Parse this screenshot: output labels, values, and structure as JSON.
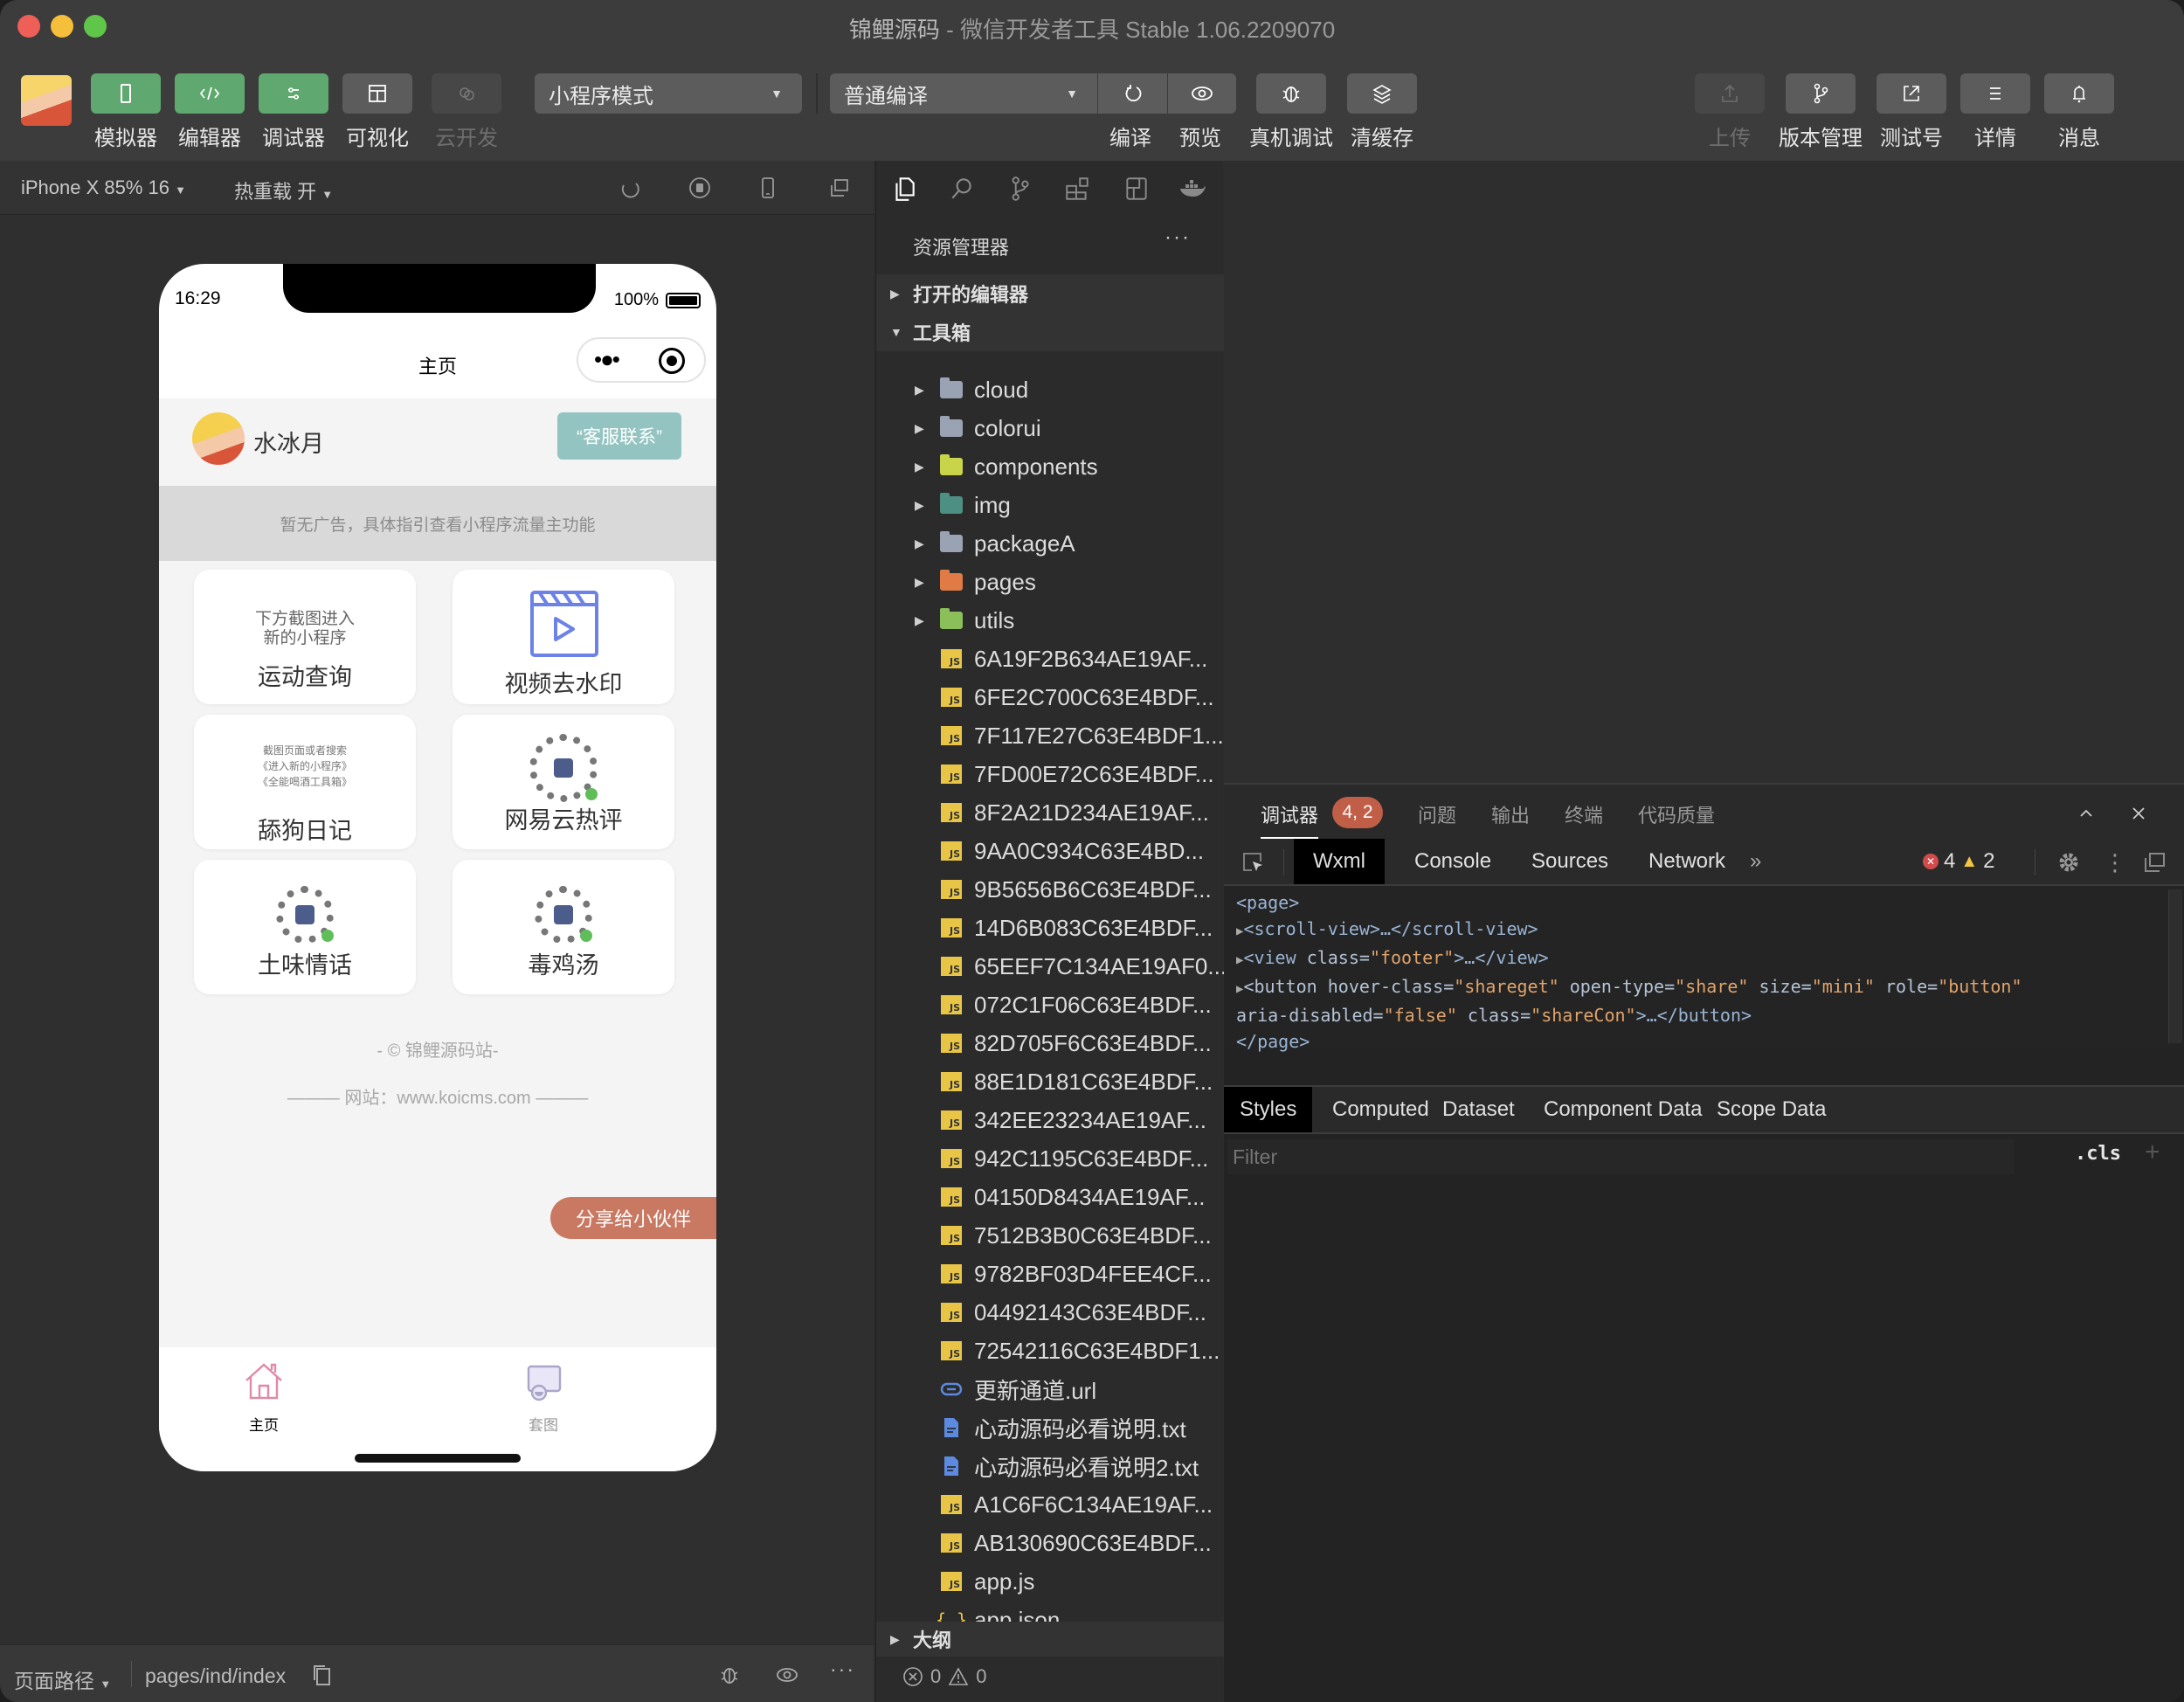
{
  "window": {
    "title_project": "锦鲤源码",
    "title_rest": " - 微信开发者工具 Stable 1.06.2209070"
  },
  "toolbar": {
    "left_buttons": [
      {
        "label": "模拟器",
        "icon": "phone-icon",
        "state": "active"
      },
      {
        "label": "编辑器",
        "icon": "code-icon",
        "state": "active"
      },
      {
        "label": "调试器",
        "icon": "sliders-icon",
        "state": "active"
      },
      {
        "label": "可视化",
        "icon": "layout-icon",
        "state": "normal"
      },
      {
        "label": "云开发",
        "icon": "cloud-icon",
        "state": "disabled"
      }
    ],
    "mode_select": "小程序模式",
    "compile_select": "普通编译",
    "mid_buttons": [
      {
        "label": "编译",
        "icon": "refresh-icon"
      },
      {
        "label": "预览",
        "icon": "eye-icon"
      },
      {
        "label": "真机调试",
        "icon": "bug-icon"
      },
      {
        "label": "清缓存",
        "icon": "layers-icon"
      }
    ],
    "right_buttons": [
      {
        "label": "上传",
        "icon": "upload-icon",
        "state": "disabled"
      },
      {
        "label": "版本管理",
        "icon": "branch-icon"
      },
      {
        "label": "测试号",
        "icon": "external-link-icon"
      },
      {
        "label": "详情",
        "icon": "menu-icon"
      },
      {
        "label": "消息",
        "icon": "bell-icon"
      }
    ]
  },
  "simulator_bar": {
    "device": "iPhone X 85% 16",
    "hot_reload": "热重载 开"
  },
  "phone": {
    "time": "16:29",
    "battery": "100%",
    "battery_level": 1.0,
    "nav_title": "主页",
    "user_name": "水冰月",
    "contact_button": "“客服联系”",
    "ad_text": "暂无广告，具体指引查看小程序流量主功能",
    "cards": [
      {
        "label": "运动查询",
        "sub": [
          "下方截图进入",
          "新的小程序"
        ],
        "type": "text"
      },
      {
        "label": "视频去水印",
        "type": "video-icon"
      },
      {
        "label": "舔狗日记",
        "sub": [
          "截图页面或者搜索",
          "《进入新的小程序》",
          "《全能喝酒工具箱》"
        ],
        "type": "text-small"
      },
      {
        "label": "网易云热评",
        "type": "qr"
      },
      {
        "label": "土味情话",
        "type": "qr"
      },
      {
        "label": "毒鸡汤",
        "type": "qr"
      }
    ],
    "copyright": "- © 锦鲤源码站-",
    "website": "——— 网站：www.koicms.com ———",
    "share_button": "分享给小伙伴",
    "tabs": [
      {
        "label": "主页",
        "active": true
      },
      {
        "label": "套图",
        "active": false
      }
    ],
    "colors": {
      "contact": "#94c4c2",
      "share": "#c97862",
      "home_icon": "#e08aa8",
      "video_icon": "#6c82e6"
    }
  },
  "bottom_bar": {
    "page_path_label": "页面路径",
    "page_path": "pages/ind/index"
  },
  "explorer": {
    "title": "资源管理器",
    "open_editors": "打开的编辑器",
    "root": "工具箱",
    "folders": [
      {
        "name": "cloud",
        "color": "#9aa3b3"
      },
      {
        "name": "colorui",
        "color": "#9aa3b3"
      },
      {
        "name": "components",
        "color": "#c8d44a"
      },
      {
        "name": "img",
        "color": "#4e8f84"
      },
      {
        "name": "packageA",
        "color": "#9aa3b3"
      },
      {
        "name": "pages",
        "color": "#e07b46"
      },
      {
        "name": "utils",
        "color": "#8bbf5a"
      }
    ],
    "files": [
      {
        "name": "6A19F2B634AE19AF...",
        "type": "js"
      },
      {
        "name": "6FE2C700C63E4BDF...",
        "type": "js"
      },
      {
        "name": "7F117E27C63E4BDF1...",
        "type": "js"
      },
      {
        "name": "7FD00E72C63E4BDF...",
        "type": "js"
      },
      {
        "name": "8F2A21D234AE19AF...",
        "type": "js"
      },
      {
        "name": "9AA0C934C63E4BD...",
        "type": "js"
      },
      {
        "name": "9B5656B6C63E4BDF...",
        "type": "js"
      },
      {
        "name": "14D6B083C63E4BDF...",
        "type": "js"
      },
      {
        "name": "65EEF7C134AE19AF0...",
        "type": "js"
      },
      {
        "name": "072C1F06C63E4BDF...",
        "type": "js"
      },
      {
        "name": "82D705F6C63E4BDF...",
        "type": "js"
      },
      {
        "name": "88E1D181C63E4BDF...",
        "type": "js"
      },
      {
        "name": "342EE23234AE19AF...",
        "type": "js"
      },
      {
        "name": "942C1195C63E4BDF...",
        "type": "js"
      },
      {
        "name": "04150D8434AE19AF...",
        "type": "js"
      },
      {
        "name": "7512B3B0C63E4BDF...",
        "type": "js"
      },
      {
        "name": "9782BF03D4FEE4CF...",
        "type": "js"
      },
      {
        "name": "04492143C63E4BDF...",
        "type": "js"
      },
      {
        "name": "72542116C63E4BDF1...",
        "type": "js"
      },
      {
        "name": "更新通道.url",
        "type": "url"
      },
      {
        "name": "心动源码必看说明.txt",
        "type": "txt"
      },
      {
        "name": "心动源码必看说明2.txt",
        "type": "txt"
      },
      {
        "name": "A1C6F6C134AE19AF...",
        "type": "js"
      },
      {
        "name": "AB130690C63E4BDF...",
        "type": "js"
      },
      {
        "name": "app.js",
        "type": "js"
      },
      {
        "name": "app.json",
        "type": "json"
      }
    ],
    "outline": "大纲",
    "errors": "0",
    "warnings": "0"
  },
  "devtools": {
    "top_tabs": [
      "调试器",
      "问题",
      "输出",
      "终端",
      "代码质量"
    ],
    "badge": "4, 2",
    "panel_tabs": [
      "Wxml",
      "Console",
      "Sources",
      "Network"
    ],
    "more": "»",
    "error_count": "4",
    "warning_count": "2",
    "wxml": {
      "open": "<page>",
      "l1_tag": "<scroll-view>…</scroll-view>",
      "l2_pre": "<view ",
      "l2_attr": "class=",
      "l2_val": "\"footer\"",
      "l2_post": ">…</view>",
      "l3": [
        {
          "a": "<button hover-class=",
          "v": "\"shareget\""
        },
        {
          "a": " open-type=",
          "v": "\"share\""
        },
        {
          "a": " size=",
          "v": "\"mini\""
        },
        {
          "a": " role=",
          "v": "\"button\""
        }
      ],
      "l4": [
        {
          "a": "aria-disabled=",
          "v": "\"false\""
        },
        {
          "a": " class=",
          "v": "\"shareCon\""
        }
      ],
      "l4_post": ">…</button>",
      "close": "</page>"
    },
    "style_tabs": [
      "Styles",
      "Computed",
      "Dataset",
      "Component Data",
      "Scope Data"
    ],
    "filter_placeholder": "Filter",
    "cls": ".cls",
    "plus": "+"
  }
}
